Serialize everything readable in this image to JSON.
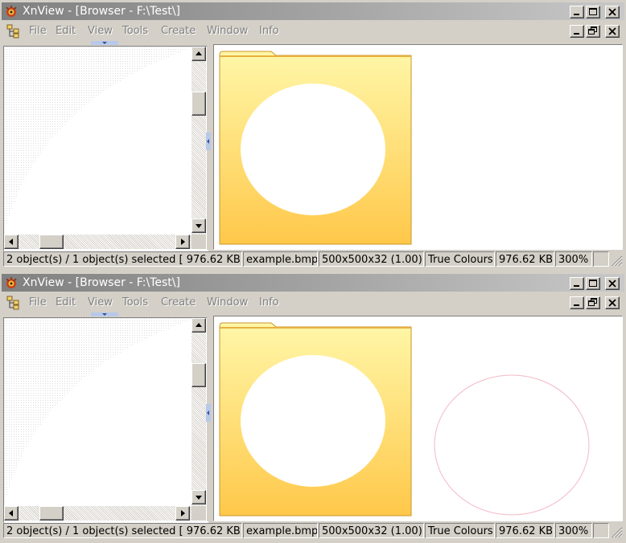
{
  "windows": [
    {
      "title": "XnView - [Browser - F:\\Test\\]",
      "menu": [
        "File",
        "Edit",
        "View",
        "Tools",
        "Create",
        "Window",
        "Info"
      ],
      "preview": "folder-with-circle",
      "status": {
        "selection": "2 object(s) / 1 object(s) selected  [ 976.62 KB ]",
        "filename": "example.bmp",
        "dimensions": "500x500x32 (1.00)",
        "colour_mode": "True Colours",
        "file_size": "976.62 KB",
        "zoom": "300%"
      }
    },
    {
      "title": "XnView - [Browser - F:\\Test\\]",
      "menu": [
        "File",
        "Edit",
        "View",
        "Tools",
        "Create",
        "Window",
        "Info"
      ],
      "preview": "folder-with-circle-and-outline-circle",
      "status": {
        "selection": "2 object(s) / 1 object(s) selected  [ 976.62 KB ]",
        "filename": "example.bmp",
        "dimensions": "500x500x32 (1.00)",
        "colour_mode": "True Colours",
        "file_size": "976.62 KB",
        "zoom": "300%"
      }
    }
  ],
  "colors": {
    "title_gradient_start": "#808080",
    "title_gradient_end": "#c8c8c8",
    "folder_top": "#fff7a8",
    "folder_bottom": "#ffc84a",
    "circle_outline": "#f4b8c4"
  },
  "icons": {
    "app": "xnview-app-icon",
    "menu": "document-tree-icon",
    "minimize": "minimize-icon",
    "maximize": "maximize-icon",
    "restore": "restore-icon",
    "close": "close-icon"
  }
}
